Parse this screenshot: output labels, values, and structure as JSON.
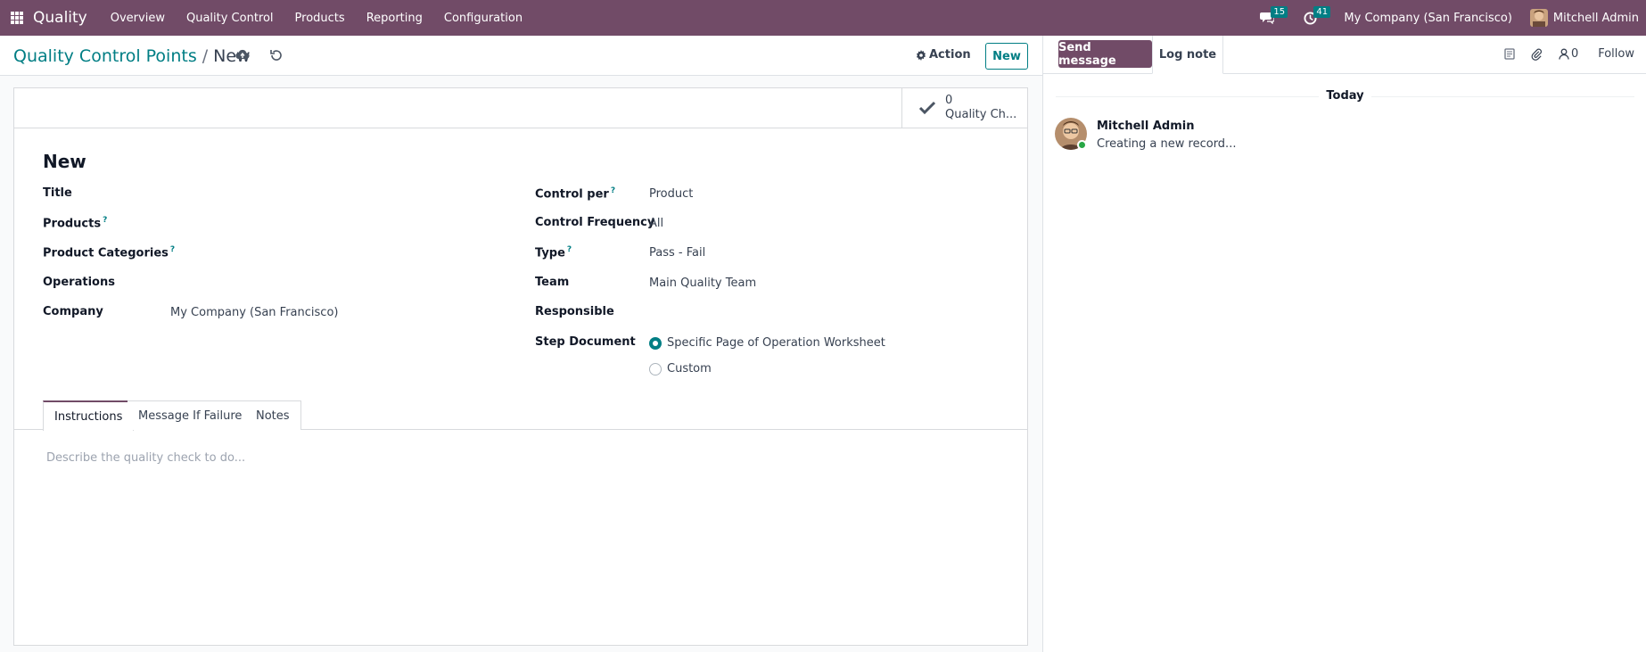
{
  "navbar": {
    "brand": "Quality",
    "menu": [
      "Overview",
      "Quality Control",
      "Products",
      "Reporting",
      "Configuration"
    ],
    "messages_count": "15",
    "activities_count": "41",
    "company": "My Company (San Francisco)",
    "user": "Mitchell Admin",
    "accent": "#714B67"
  },
  "control": {
    "breadcrumb_parent": "Quality Control Points",
    "breadcrumb_sep": "/",
    "breadcrumb_current": "New",
    "action_label": "Action",
    "new_label": "New"
  },
  "form": {
    "smart_button": {
      "count": "0",
      "label": "Quality Ch..."
    },
    "title": "New",
    "left_fields": [
      {
        "label": "Title",
        "value": "",
        "help": ""
      },
      {
        "label": "Products",
        "value": "",
        "help": "?"
      },
      {
        "label": "Product Categories",
        "value": "",
        "help": "?"
      },
      {
        "label": "Operations",
        "value": "",
        "help": ""
      },
      {
        "label": "Company",
        "value": "My Company (San Francisco)",
        "help": ""
      }
    ],
    "right_fields": [
      {
        "label": "Control per",
        "value": "Product",
        "help": "?"
      },
      {
        "label": "Control Frequency",
        "value": "All",
        "help": ""
      },
      {
        "label": "Type",
        "value": "Pass - Fail",
        "help": "?"
      },
      {
        "label": "Team",
        "value": "Main Quality Team",
        "help": ""
      },
      {
        "label": "Responsible",
        "value": "",
        "help": ""
      }
    ],
    "step_document": {
      "label": "Step Document",
      "options": [
        "Specific Page of Operation Worksheet",
        "Custom"
      ],
      "selected": "Specific Page of Operation Worksheet"
    },
    "tabs": [
      "Instructions",
      "Message If Failure",
      "Notes"
    ],
    "active_tab": "Instructions",
    "instructions_placeholder": "Describe the quality check to do..."
  },
  "chatter": {
    "send_message": "Send message",
    "log_note": "Log note",
    "followers_count": "0",
    "follow": "Follow",
    "date_separator": "Today",
    "messages": [
      {
        "author": "Mitchell Admin",
        "body": "Creating a new record..."
      }
    ]
  }
}
